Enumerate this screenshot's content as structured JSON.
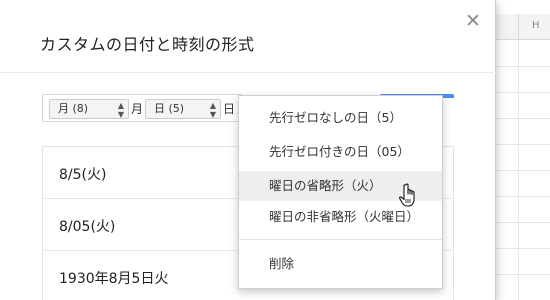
{
  "background_sheet": {
    "column_header": "H"
  },
  "dialog": {
    "title": "カスタムの日付と時刻の形式",
    "close_icon": "close-icon",
    "format_bar": {
      "month_chip": "月 (8)",
      "month_suffix": "月",
      "day_chip": "日 (5)",
      "day_suffix": "日"
    },
    "preview": [
      "8/5(火)",
      "8/05(火)",
      "1930年8月5日火"
    ]
  },
  "menu": {
    "items": [
      "先行ゼロなしの日（5）",
      "先行ゼロ付きの日（05）",
      "曜日の省略形（火）",
      "曜日の非省略形（火曜日）"
    ],
    "hover_index": 2,
    "delete_label": "削除"
  },
  "colors": {
    "accent": "#4a8af4",
    "hover_bg": "#eeeeee"
  }
}
